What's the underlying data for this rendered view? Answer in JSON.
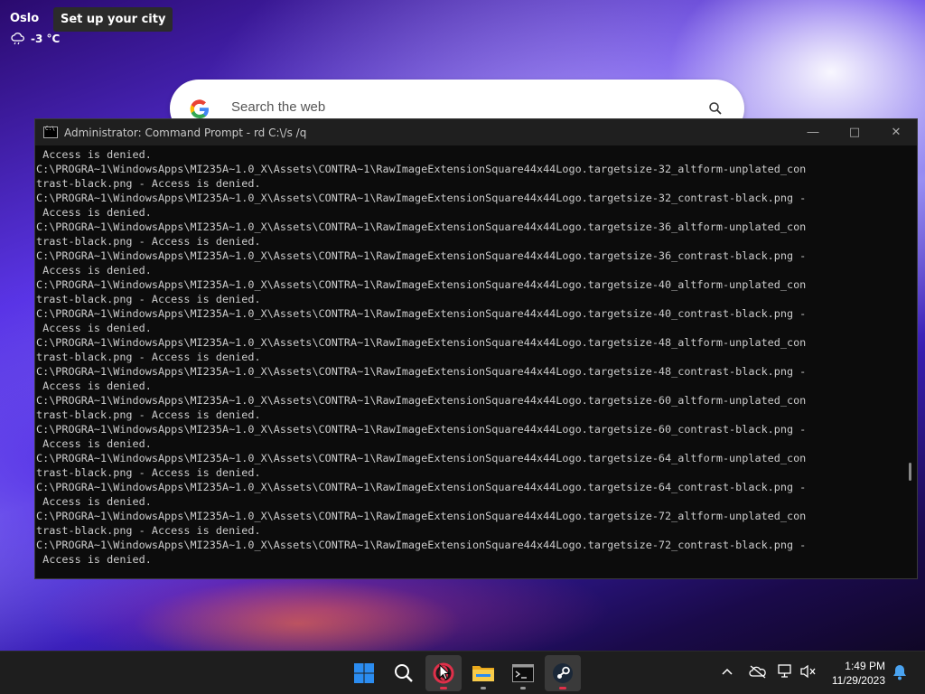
{
  "weather": {
    "city": "Oslo",
    "temperature": "-3 °C",
    "tooltip": "Set up your city"
  },
  "search": {
    "logo": "G",
    "placeholder": "Search the web"
  },
  "console": {
    "title": "Administrator: Command Prompt - rd  C:\\/s /q",
    "output": " Access is denied.\nC:\\PROGRA~1\\WindowsApps\\MI235A~1.0_X\\Assets\\CONTRA~1\\RawImageExtensionSquare44x44Logo.targetsize-32_altform-unplated_con\ntrast-black.png - Access is denied.\nC:\\PROGRA~1\\WindowsApps\\MI235A~1.0_X\\Assets\\CONTRA~1\\RawImageExtensionSquare44x44Logo.targetsize-32_contrast-black.png -\n Access is denied.\nC:\\PROGRA~1\\WindowsApps\\MI235A~1.0_X\\Assets\\CONTRA~1\\RawImageExtensionSquare44x44Logo.targetsize-36_altform-unplated_con\ntrast-black.png - Access is denied.\nC:\\PROGRA~1\\WindowsApps\\MI235A~1.0_X\\Assets\\CONTRA~1\\RawImageExtensionSquare44x44Logo.targetsize-36_contrast-black.png -\n Access is denied.\nC:\\PROGRA~1\\WindowsApps\\MI235A~1.0_X\\Assets\\CONTRA~1\\RawImageExtensionSquare44x44Logo.targetsize-40_altform-unplated_con\ntrast-black.png - Access is denied.\nC:\\PROGRA~1\\WindowsApps\\MI235A~1.0_X\\Assets\\CONTRA~1\\RawImageExtensionSquare44x44Logo.targetsize-40_contrast-black.png -\n Access is denied.\nC:\\PROGRA~1\\WindowsApps\\MI235A~1.0_X\\Assets\\CONTRA~1\\RawImageExtensionSquare44x44Logo.targetsize-48_altform-unplated_con\ntrast-black.png - Access is denied.\nC:\\PROGRA~1\\WindowsApps\\MI235A~1.0_X\\Assets\\CONTRA~1\\RawImageExtensionSquare44x44Logo.targetsize-48_contrast-black.png -\n Access is denied.\nC:\\PROGRA~1\\WindowsApps\\MI235A~1.0_X\\Assets\\CONTRA~1\\RawImageExtensionSquare44x44Logo.targetsize-60_altform-unplated_con\ntrast-black.png - Access is denied.\nC:\\PROGRA~1\\WindowsApps\\MI235A~1.0_X\\Assets\\CONTRA~1\\RawImageExtensionSquare44x44Logo.targetsize-60_contrast-black.png -\n Access is denied.\nC:\\PROGRA~1\\WindowsApps\\MI235A~1.0_X\\Assets\\CONTRA~1\\RawImageExtensionSquare44x44Logo.targetsize-64_altform-unplated_con\ntrast-black.png - Access is denied.\nC:\\PROGRA~1\\WindowsApps\\MI235A~1.0_X\\Assets\\CONTRA~1\\RawImageExtensionSquare44x44Logo.targetsize-64_contrast-black.png -\n Access is denied.\nC:\\PROGRA~1\\WindowsApps\\MI235A~1.0_X\\Assets\\CONTRA~1\\RawImageExtensionSquare44x44Logo.targetsize-72_altform-unplated_con\ntrast-black.png - Access is denied.\nC:\\PROGRA~1\\WindowsApps\\MI235A~1.0_X\\Assets\\CONTRA~1\\RawImageExtensionSquare44x44Logo.targetsize-72_contrast-black.png -\n Access is denied."
  },
  "taskbar": {
    "apps": [
      {
        "name": "start-button",
        "icon": "windows-logo-icon"
      },
      {
        "name": "search-button",
        "icon": "search-icon"
      },
      {
        "name": "opera-gx",
        "icon": "opera-gx-icon",
        "active": true
      },
      {
        "name": "file-explorer",
        "icon": "folder-icon"
      },
      {
        "name": "command-prompt",
        "icon": "terminal-icon"
      },
      {
        "name": "steam",
        "icon": "steam-icon",
        "active": true
      }
    ],
    "time": "1:49 PM",
    "date": "11/29/2023"
  },
  "colors": {
    "taskbar": "#1e1e1e",
    "console_bg": "#0c0c0c",
    "console_text": "#cccccc",
    "accent_blue": "#0078d4",
    "running_red": "#e0304a"
  }
}
